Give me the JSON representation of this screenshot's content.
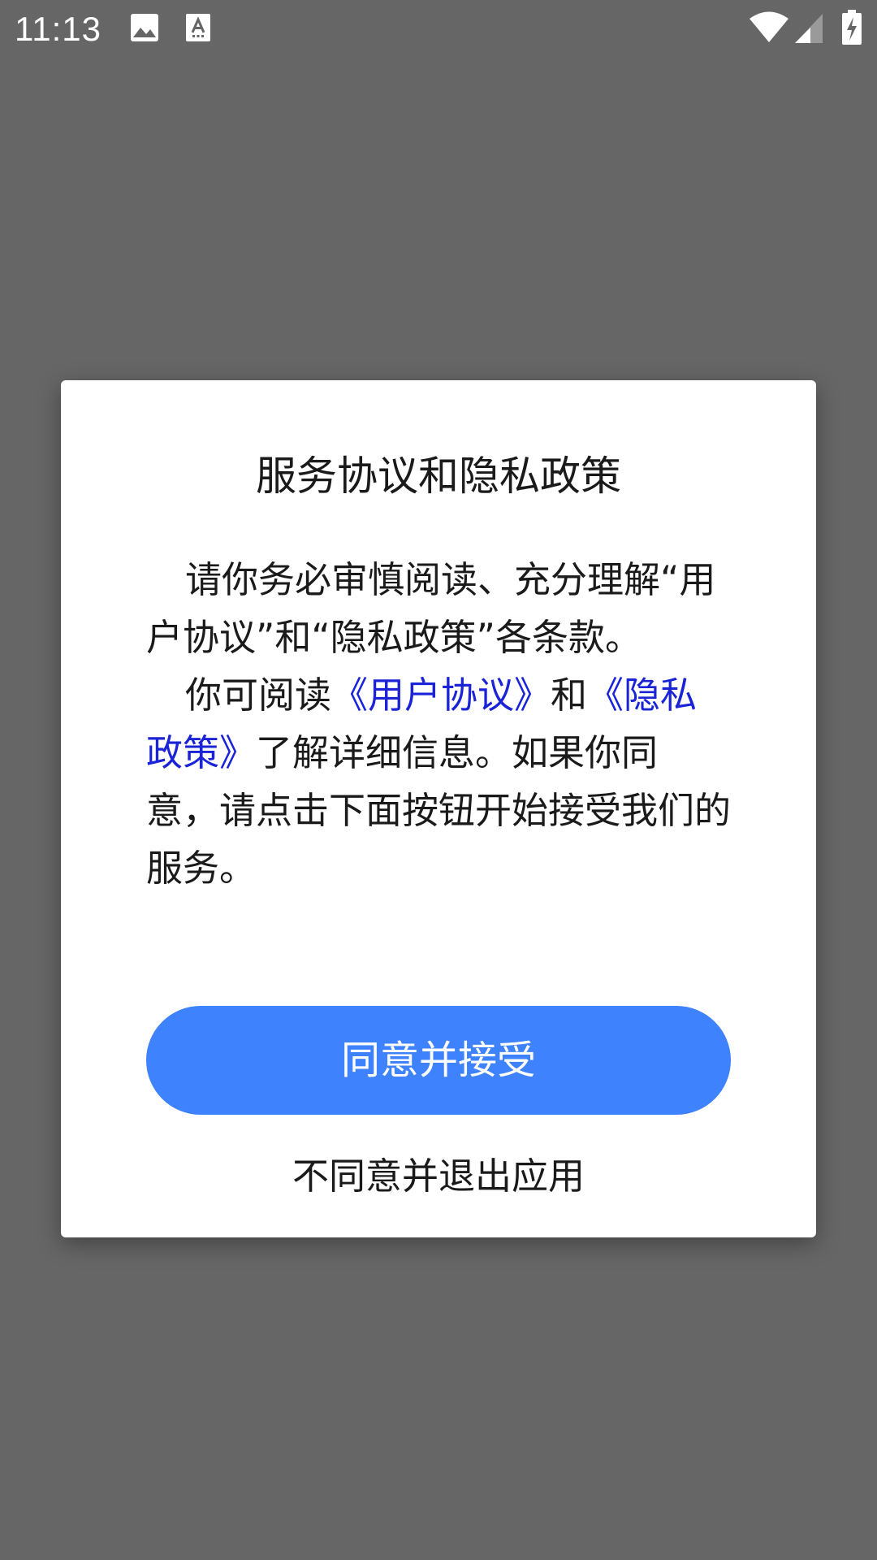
{
  "status_bar": {
    "time": "11:13",
    "icons": [
      "image-icon",
      "font-icon",
      "wifi-icon",
      "signal-icon",
      "battery-charging-icon"
    ]
  },
  "dialog": {
    "title": "服务协议和隐私政策",
    "para1": "请你务必审慎阅读、充分理解“用户协议”和“隐私政策”各条款。",
    "para2_prefix": "你可阅读",
    "link_user_agreement": "《用户协议》",
    "para2_and": "和",
    "link_privacy_policy": "《隐私政策》",
    "para2_suffix": "了解详细信息。如果你同意，请点击下面按钮开始接受我们的服务。",
    "agree_label": "同意并接受",
    "decline_label": "不同意并退出应用"
  },
  "colors": {
    "backdrop": "#666666",
    "accent": "#3e82fd",
    "link": "#1a23d6"
  }
}
